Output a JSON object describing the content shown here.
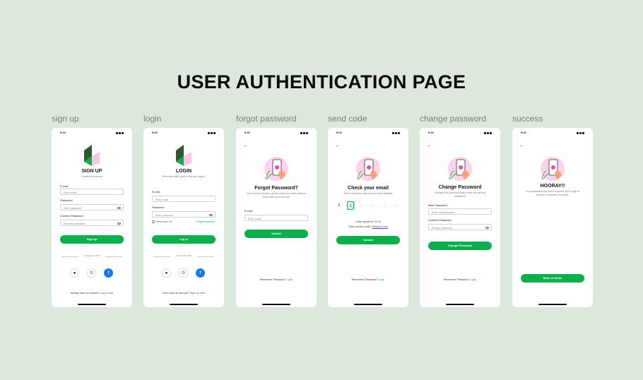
{
  "title": "USER AUTHENTICATION PAGE",
  "labels": [
    "sign up",
    "login",
    "forgot password",
    "send code",
    "change password",
    "success"
  ],
  "status_time": "9:41",
  "signup": {
    "heading": "SIGN UP",
    "subtitle": "Create an account",
    "email_label": "E-mail",
    "email_placeholder": "Enter email",
    "password_label": "Password",
    "password_placeholder": "Enter password",
    "confirm_label": "Confirm Password",
    "confirm_placeholder": "Re-enter password",
    "button": "Sign Up",
    "divider": "or sign up with",
    "footer": "Already have an account?",
    "footer_link": "Log in here"
  },
  "login": {
    "heading": "LOGIN",
    "subtitle": "Welcome back, glad to see you again!",
    "email_label": "E-mail",
    "email_placeholder": "Enter email",
    "password_label": "Password",
    "password_placeholder": "Enter password",
    "remember": "Remember me",
    "forgot": "Forgot Password?",
    "button": "Log In",
    "divider": "or sign in with",
    "footer": "Don't have an account?",
    "footer_link": "Sign Up here"
  },
  "forgot": {
    "heading": "Forgot Password?",
    "subtitle": "Don't worry it occurs, please enter the email address linked with your account.",
    "email_label": "E-mail",
    "email_placeholder": "Enter email",
    "button": "Submit",
    "footer": "Remember Password?",
    "footer_link": "Login"
  },
  "sendcode": {
    "heading": "Check your email",
    "subtitle": "We've send the code to your email address",
    "digits": [
      "6",
      "1",
      "-",
      "-",
      "-",
      "-"
    ],
    "expire": "Code expired in:",
    "expire_time": "00:32",
    "resend": "Didn't receive code?",
    "resend_link": "Resend Code",
    "button": "Submit",
    "footer": "Remember Password?",
    "footer_link": "Login"
  },
  "change": {
    "heading": "Change Password",
    "subtitle": "Replace the password with a new and strong characters.",
    "new_label": "New Password",
    "new_placeholder": "Enter new password",
    "confirm_label": "Confirm Password",
    "confirm_placeholder": "Re-type password",
    "button": "Change Password",
    "footer": "Remember Password?",
    "footer_link": "Login"
  },
  "success": {
    "heading": "HOORAY!!",
    "subtitle": "Your password has been replaced, try to login to explore & discover the world.",
    "button": "Back to Home"
  },
  "colors": {
    "background": "#dce8dc",
    "accent": "#0bb04c",
    "link": "#5a38d6",
    "logo_dark": "#2d5a27",
    "logo_pink": "#f7c8e6"
  }
}
